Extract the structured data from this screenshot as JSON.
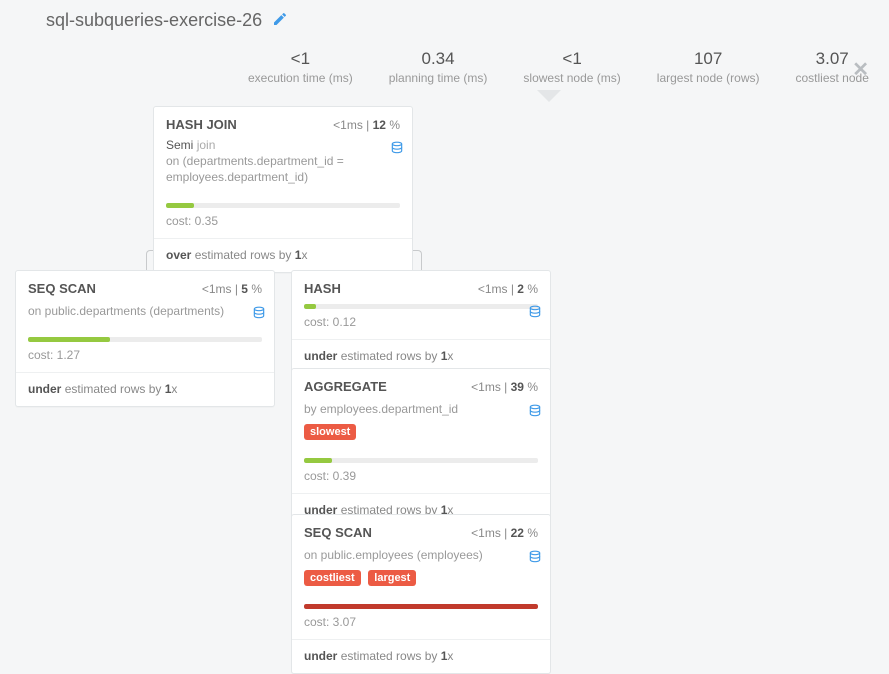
{
  "title": "sql-subqueries-exercise-26",
  "metrics": [
    {
      "value": "<1",
      "label": "execution time (ms)"
    },
    {
      "value": "0.34",
      "label": "planning time (ms)"
    },
    {
      "value": "<1",
      "label": "slowest node (ms)"
    },
    {
      "value": "107",
      "label": "largest node (rows)"
    },
    {
      "value": "3.07",
      "label": "costliest node"
    }
  ],
  "nodes": {
    "hashjoin": {
      "type": "HASH JOIN",
      "time": "<1ms",
      "pct": "12",
      "sub1a": "Semi",
      "sub1b": "join",
      "sub2": "on (departments.department_id = employees.department_id)",
      "bar_pct": 12,
      "bar_color": "g",
      "cost": "cost: 0.35",
      "est_pre": "over",
      "est_mid": "estimated rows by",
      "est_fac": "1"
    },
    "seqscan1": {
      "type": "SEQ SCAN",
      "time": "<1ms",
      "pct": "5",
      "sub2": "on public.departments (departments)",
      "bar_pct": 35,
      "bar_color": "g",
      "cost": "cost: 1.27",
      "est_pre": "under",
      "est_mid": "estimated rows by",
      "est_fac": "1"
    },
    "hash": {
      "type": "HASH",
      "time": "<1ms",
      "pct": "2",
      "bar_pct": 5,
      "bar_color": "g",
      "cost": "cost: 0.12",
      "est_pre": "under",
      "est_mid": "estimated rows by",
      "est_fac": "1"
    },
    "aggregate": {
      "type": "AGGREGATE",
      "time": "<1ms",
      "pct": "39",
      "sub2": "by employees.department_id",
      "badges": [
        "slowest"
      ],
      "bar_pct": 12,
      "bar_color": "g",
      "cost": "cost: 0.39",
      "est_pre": "under",
      "est_mid": "estimated rows by",
      "est_fac": "1"
    },
    "seqscan2": {
      "type": "SEQ SCAN",
      "time": "<1ms",
      "pct": "22",
      "sub2": "on public.employees (employees)",
      "badges": [
        "costliest",
        "largest"
      ],
      "bar_pct": 100,
      "bar_color": "r",
      "cost": "cost: 3.07",
      "est_pre": "under",
      "est_mid": "estimated rows by",
      "est_fac": "1"
    }
  }
}
